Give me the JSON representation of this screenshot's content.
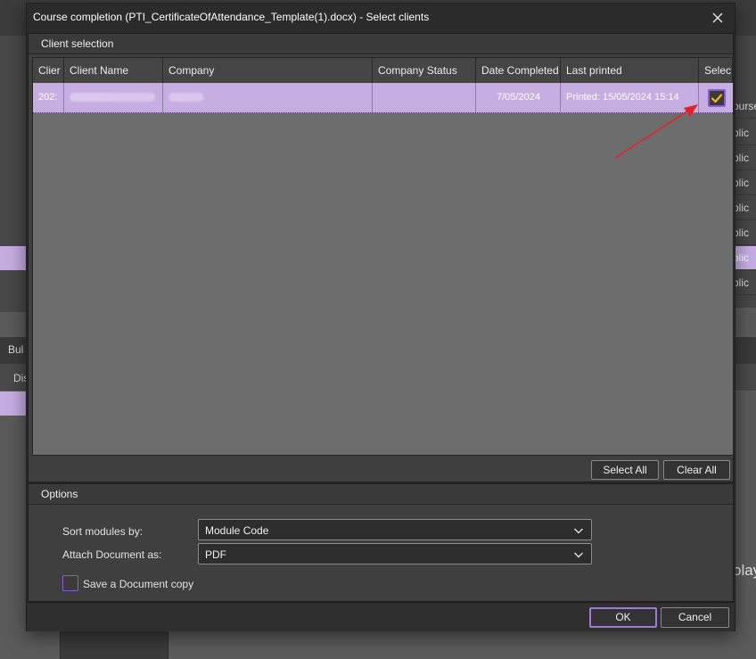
{
  "background": {
    "right_rows": [
      "ourse T",
      "blic",
      "blic",
      "blic",
      "blic",
      "blic",
      "blic",
      "blic"
    ],
    "left_button": "Bul",
    "left_header": "Dis",
    "right_text": "olay"
  },
  "dialog": {
    "title": "Course completion (PTI_CertificateOfAttendance_Template(1).docx) - Select clients",
    "client_selection": {
      "title": "Client selection",
      "columns": [
        "Clier",
        "Client Name",
        "Company",
        "Company Status",
        "Date Completed",
        "Last printed",
        "Selec"
      ],
      "rows": [
        {
          "client_id": "202:",
          "client_name": "",
          "company": "",
          "company_status": "",
          "date_completed": "7/05/2024",
          "last_printed": "Printed: 15/05/2024 15:14",
          "selected": true
        }
      ],
      "select_all_label": "Select All",
      "clear_all_label": "Clear All"
    },
    "options": {
      "title": "Options",
      "sort_label": "Sort modules by:",
      "sort_value": "Module Code",
      "attach_label": "Attach Document as:",
      "attach_value": "PDF",
      "save_copy_label": "Save a Document copy",
      "save_copy_checked": false
    },
    "ok_label": "OK",
    "cancel_label": "Cancel"
  },
  "colors": {
    "selection": "#c6aee3",
    "accent": "#8c5ad0",
    "checkmark": "#f0b429",
    "annotation_arrow": "#e0232a"
  },
  "icons": [
    "close-icon",
    "chevron-down-icon",
    "checkmark-icon",
    "annotation-arrow-icon"
  ]
}
